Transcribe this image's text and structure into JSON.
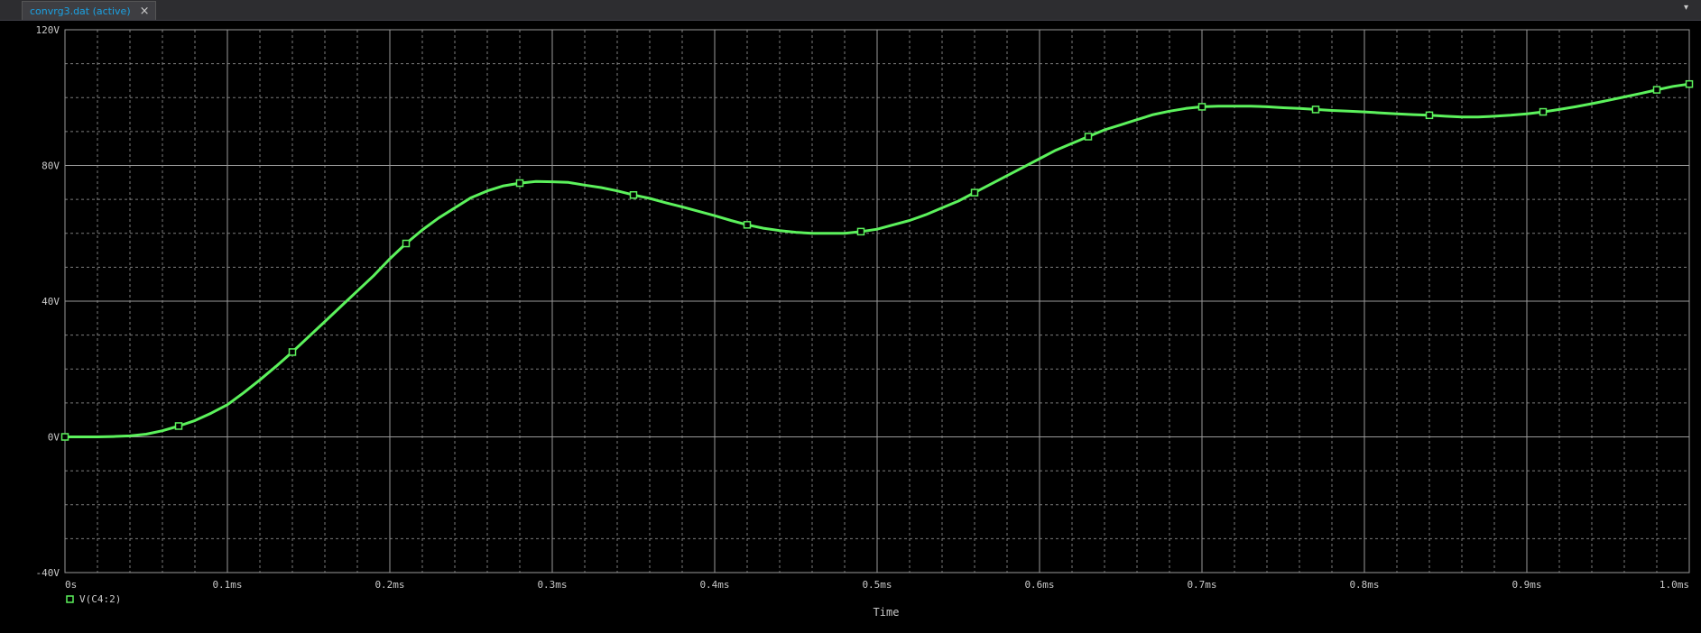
{
  "window": {
    "tab_label": "convrg3.dat (active)",
    "close_glyph": "×",
    "dropdown_glyph": "▾"
  },
  "colors": {
    "background": "#000000",
    "grid": "#9a9a9a",
    "axis_text": "#c8c8c8",
    "trace": "#5cf25c",
    "tab_text": "#1ba1e2"
  },
  "chart_data": {
    "type": "line",
    "title": "",
    "xlabel": "Time",
    "ylabel": "",
    "xlim": [
      0,
      1.0
    ],
    "ylim": [
      -40,
      120
    ],
    "x_unit": "ms",
    "xticks": [
      0,
      0.1,
      0.2,
      0.3,
      0.4,
      0.5,
      0.6,
      0.7,
      0.8,
      0.9,
      1.0
    ],
    "xtick_labels": [
      "0s",
      "0.1ms",
      "0.2ms",
      "0.3ms",
      "0.4ms",
      "0.5ms",
      "0.6ms",
      "0.7ms",
      "0.8ms",
      "0.9ms",
      "1.0ms"
    ],
    "yticks": [
      -40,
      0,
      40,
      80,
      120
    ],
    "ytick_labels": [
      "-40V",
      "0V",
      "40V",
      "80V",
      "120V"
    ],
    "grid": true,
    "minor_grid": "dotted",
    "legend_position": "bottom-left",
    "series": [
      {
        "name": "V(C4:2)",
        "marker": "square",
        "x": [
          0,
          0.01,
          0.02,
          0.03,
          0.04,
          0.05,
          0.06,
          0.07,
          0.08,
          0.09,
          0.1,
          0.11,
          0.12,
          0.13,
          0.14,
          0.15,
          0.16,
          0.17,
          0.18,
          0.19,
          0.2,
          0.21,
          0.22,
          0.23,
          0.24,
          0.25,
          0.26,
          0.27,
          0.28,
          0.29,
          0.3,
          0.31,
          0.32,
          0.33,
          0.34,
          0.35,
          0.36,
          0.37,
          0.38,
          0.39,
          0.4,
          0.41,
          0.42,
          0.43,
          0.44,
          0.45,
          0.46,
          0.47,
          0.48,
          0.49,
          0.5,
          0.51,
          0.52,
          0.53,
          0.54,
          0.55,
          0.56,
          0.57,
          0.58,
          0.59,
          0.6,
          0.61,
          0.62,
          0.63,
          0.64,
          0.65,
          0.66,
          0.67,
          0.68,
          0.69,
          0.7,
          0.71,
          0.72,
          0.73,
          0.74,
          0.75,
          0.76,
          0.77,
          0.78,
          0.79,
          0.8,
          0.81,
          0.82,
          0.83,
          0.84,
          0.85,
          0.86,
          0.87,
          0.88,
          0.89,
          0.9,
          0.91,
          0.92,
          0.93,
          0.94,
          0.95,
          0.96,
          0.97,
          0.98,
          0.99,
          1.0
        ],
        "y": [
          0,
          0,
          0,
          0.1,
          0.3,
          0.8,
          1.8,
          3.2,
          4.8,
          7,
          9.5,
          13,
          16.8,
          20.8,
          25,
          29.5,
          34,
          38.5,
          43,
          47.5,
          52.5,
          57,
          61,
          64.5,
          67.5,
          70.5,
          72.5,
          74,
          74.8,
          75.3,
          75.2,
          75,
          74.2,
          73.5,
          72.5,
          71.3,
          70.3,
          69,
          67.8,
          66.5,
          65.2,
          63.8,
          62.5,
          61.5,
          60.8,
          60.3,
          60,
          60,
          60,
          60.5,
          61.2,
          62.5,
          63.8,
          65.5,
          67.5,
          69.5,
          72,
          74.5,
          77,
          79.5,
          82,
          84.5,
          86.5,
          88.5,
          90.5,
          92,
          93.5,
          95,
          96,
          96.8,
          97.3,
          97.5,
          97.5,
          97.5,
          97.3,
          97,
          96.8,
          96.5,
          96.2,
          96,
          95.8,
          95.5,
          95.2,
          95,
          94.8,
          94.5,
          94.3,
          94.3,
          94.5,
          94.8,
          95.2,
          95.8,
          96.5,
          97.3,
          98.2,
          99.2,
          100.2,
          101.2,
          102.3,
          103.3,
          104
        ]
      }
    ]
  }
}
